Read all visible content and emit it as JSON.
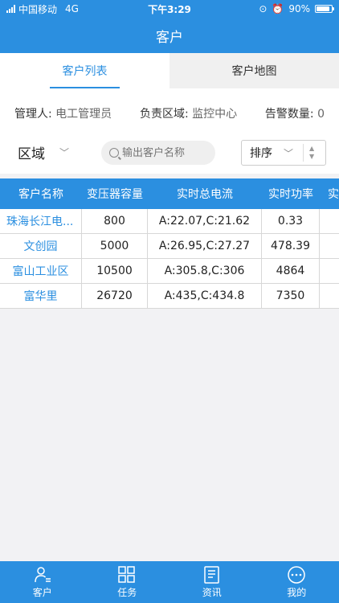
{
  "status_bar": {
    "carrier": "中国移动",
    "network": "4G",
    "time": "下午3:29",
    "battery": "90%",
    "battery_level": 0.9
  },
  "nav": {
    "title": "客户"
  },
  "tabs": [
    {
      "label": "客户列表",
      "active": true
    },
    {
      "label": "客户地图",
      "active": false
    }
  ],
  "info": {
    "manager_label": "管理人:",
    "manager_value": "电工管理员",
    "area_label": "负责区域:",
    "area_value": "监控中心",
    "alarm_label": "告警数量:",
    "alarm_value": "0"
  },
  "filters": {
    "area_label": "区域",
    "search_placeholder": "输出客户名称",
    "sort_label": "排序"
  },
  "table": {
    "headers": [
      "客户名称",
      "变压器容量",
      "实时总电流",
      "实时功率",
      "实"
    ],
    "rows": [
      {
        "name": "珠海长江电...",
        "capacity": "800",
        "current": "A:22.07,C:21.62",
        "power": "0.33"
      },
      {
        "name": "文创园",
        "capacity": "5000",
        "current": "A:26.95,C:27.27",
        "power": "478.39"
      },
      {
        "name": "富山工业区",
        "capacity": "10500",
        "current": "A:305.8,C:306",
        "power": "4864"
      },
      {
        "name": "富华里",
        "capacity": "26720",
        "current": "A:435,C:434.8",
        "power": "7350"
      }
    ]
  },
  "tabbar": [
    {
      "label": "客户",
      "icon": "customer-icon"
    },
    {
      "label": "任务",
      "icon": "grid-icon"
    },
    {
      "label": "资讯",
      "icon": "news-icon"
    },
    {
      "label": "我的",
      "icon": "more-icon"
    }
  ],
  "colors": {
    "primary": "#2b8fe0",
    "background": "#f2f2f4"
  }
}
